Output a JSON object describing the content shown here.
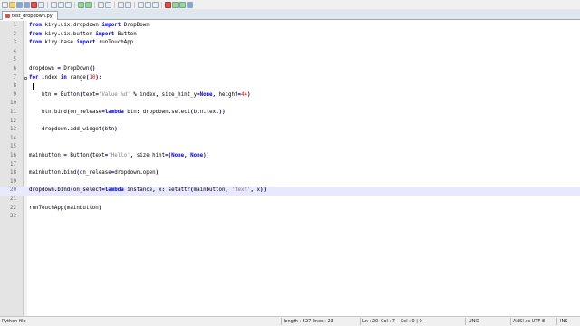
{
  "tab": {
    "label": "test_dropdown.py"
  },
  "lines": [
    {
      "n": "1",
      "text": "from kivy.uix.dropdown import DropDown"
    },
    {
      "n": "2",
      "text": "from kivy.uix.button import Button"
    },
    {
      "n": "3",
      "text": "from kivy.base import runTouchApp"
    },
    {
      "n": "4",
      "text": ""
    },
    {
      "n": "5",
      "text": ""
    },
    {
      "n": "6",
      "text": "dropdown = DropDown()"
    },
    {
      "n": "7",
      "text": "for index in range(10):"
    },
    {
      "n": "8",
      "text": ""
    },
    {
      "n": "9",
      "text": "    btn = Button(text='Value %d' % index, size_hint_y=None, height=44)"
    },
    {
      "n": "10",
      "text": ""
    },
    {
      "n": "11",
      "text": "    btn.bind(on_release=lambda btn: dropdown.select(btn.text))"
    },
    {
      "n": "12",
      "text": ""
    },
    {
      "n": "13",
      "text": "    dropdown.add_widget(btn)"
    },
    {
      "n": "14",
      "text": ""
    },
    {
      "n": "15",
      "text": ""
    },
    {
      "n": "16",
      "text": "mainbutton = Button(text='Hello', size_hint=(None, None))"
    },
    {
      "n": "17",
      "text": ""
    },
    {
      "n": "18",
      "text": "mainbutton.bind(on_release=dropdown.open)"
    },
    {
      "n": "19",
      "text": ""
    },
    {
      "n": "20",
      "text": "dropdown.bind(on_select=lambda instance, x: setattr(mainbutton, 'text', x))"
    },
    {
      "n": "21",
      "text": ""
    },
    {
      "n": "22",
      "text": "runTouchApp(mainbutton)"
    },
    {
      "n": "23",
      "text": ""
    }
  ],
  "status": {
    "file_type": "Python file",
    "length": "length : 527",
    "lines": "lines : 23",
    "ln": "Ln : 20",
    "col": "Col : 7",
    "sel": "Sel : 0 | 0",
    "eol": "UNIX",
    "encoding": "ANSI as UTF-8",
    "mode": "INS"
  },
  "colors": {
    "keyword": "#0000ff",
    "string": "#808080",
    "number": "#ff0000",
    "current_line": "#e8e8ff"
  },
  "icons": [
    "new-file-icon",
    "open-icon",
    "save-icon",
    "save-all-icon",
    "close-icon",
    "print-icon",
    "cut-icon",
    "copy-icon",
    "paste-icon",
    "undo-icon",
    "redo-icon",
    "find-icon",
    "replace-icon",
    "zoom-in-icon",
    "zoom-out-icon",
    "sync-icon",
    "wrap-icon",
    "indent-guide-icon",
    "macro-record-icon",
    "macro-play-icon",
    "run-icon"
  ]
}
